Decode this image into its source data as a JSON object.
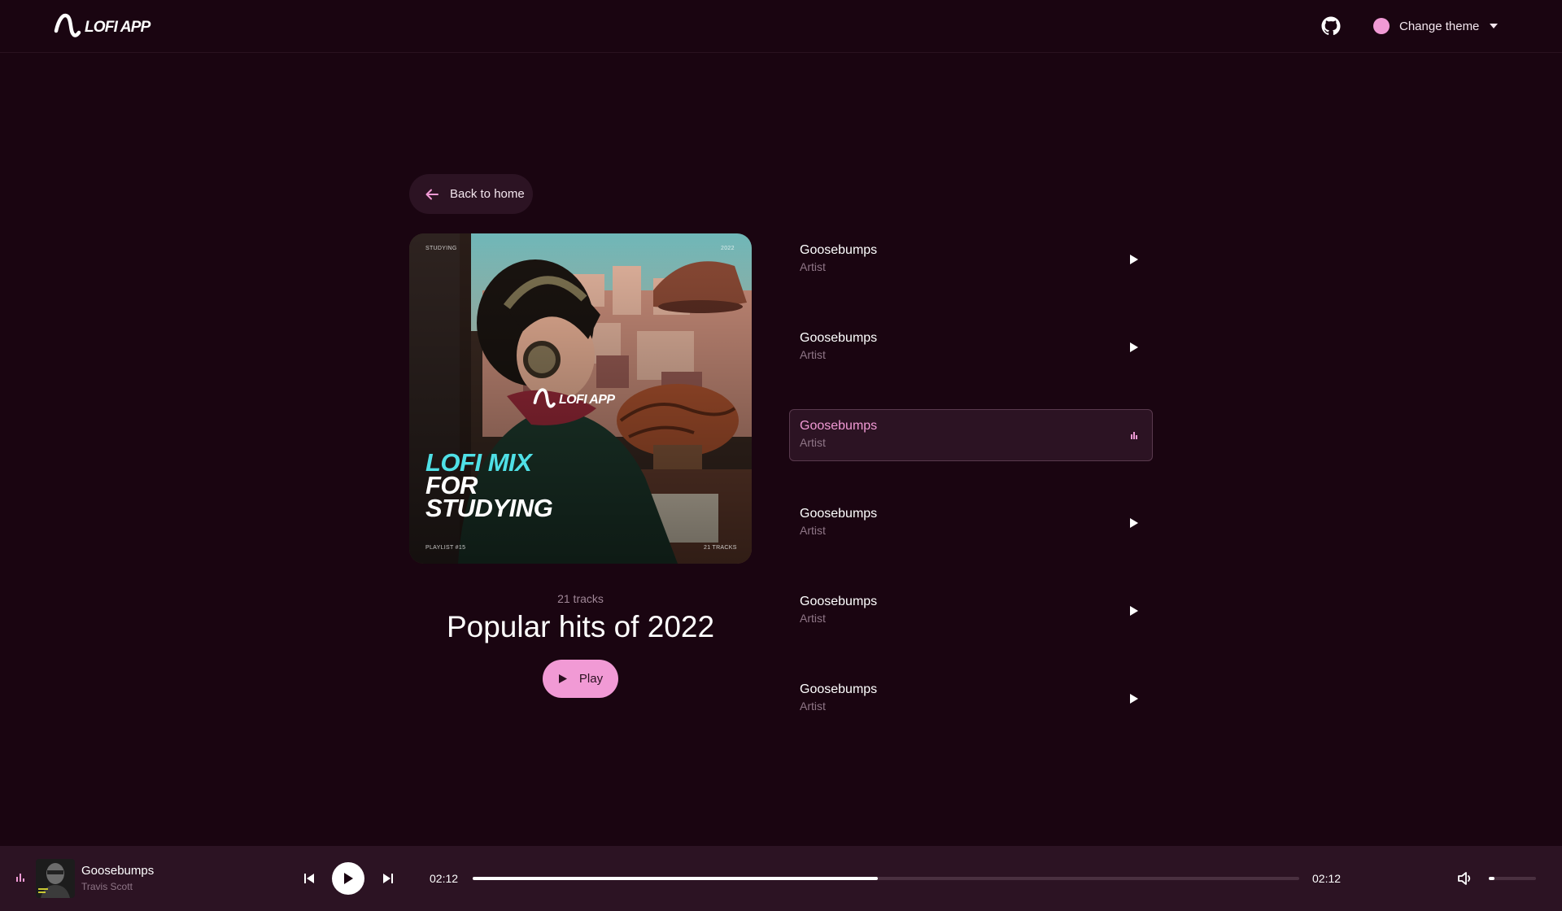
{
  "header": {
    "logo_text": "LOFI APP",
    "github_icon": "github-icon",
    "theme_label": "Change theme",
    "theme_color": "#f19ad5"
  },
  "back": {
    "label": "Back to home",
    "icon": "arrow-left-icon"
  },
  "cover": {
    "top_left": "STUDYING",
    "top_right": "2022",
    "logo_text": "LOFI APP",
    "line1": "LOFI MIX",
    "line2": "FOR",
    "line3": "STUDYING",
    "bottom_left": "PLAYLIST #15",
    "bottom_right": "21 TRACKS"
  },
  "playlist": {
    "tracks_count": "21 tracks",
    "title": "Popular hits of 2022",
    "play_label": "Play"
  },
  "tracks": [
    {
      "title": "Goosebumps",
      "artist": "Artist",
      "active": false
    },
    {
      "title": "Goosebumps",
      "artist": "Artist",
      "active": false
    },
    {
      "title": "Goosebumps",
      "artist": "Artist",
      "active": true
    },
    {
      "title": "Goosebumps",
      "artist": "Artist",
      "active": false
    },
    {
      "title": "Goosebumps",
      "artist": "Artist",
      "active": false
    },
    {
      "title": "Goosebumps",
      "artist": "Artist",
      "active": false
    }
  ],
  "player": {
    "title": "Goosebumps",
    "artist": "Travis Scott",
    "current_time": "02:12",
    "duration": "02:12",
    "progress": 0.49,
    "volume": 0.12
  },
  "colors": {
    "background": "#1a0511",
    "surface": "#2c1323",
    "accent": "#f19ad5",
    "muted": "#8f7687"
  }
}
